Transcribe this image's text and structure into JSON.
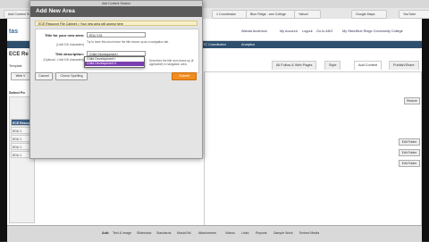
{
  "browser_tabs": [
    "Add Content Section",
    "Dashboard",
    "1 Coordinator",
    "Blue Ridge - ann College",
    "Yahoo!",
    "Google Maps",
    "YouTube",
    "Working Conditions",
    "Online Scheduling",
    "Community College",
    "sbt",
    "1 Coordinator",
    "Coordinator",
    "Coordinator",
    "Announcements"
  ],
  "header": {
    "logo": "tas",
    "links": [
      "Wanda Anderson",
      "My Account",
      "Logout",
      "Go to ANG",
      "My Sites",
      "Blue Ridge Community College"
    ]
  },
  "nav": {
    "items": [
      "TC Coordinator",
      "Analytics"
    ]
  },
  "page": {
    "title": "ECE Re",
    "template_label": "Template",
    "web_button": "Web V"
  },
  "page_tabs": [
    "All Follow & Web Pages",
    "Style",
    "Add Content",
    "Publish/Share"
  ],
  "sidebar": {
    "title": "Select Fo",
    "head_item": "ECE Resou",
    "items": [
      "EDU 1",
      "EDU 1",
      "EDU 1",
      "EDU 1"
    ]
  },
  "edit_buttons": [
    "Restore",
    "Edit Folder",
    "Edit Folder",
    "Edit Folder"
  ],
  "bottombar": {
    "add_label": "Add:",
    "items": [
      "Text & Image",
      "Slideshow",
      "Standards",
      "Music/Vid",
      "Attachments",
      "Videos",
      "Links",
      "Reports",
      "Sample Work",
      "Embed Media"
    ]
  },
  "dialog": {
    "window_title": "Add Content Section",
    "title": "Add New Area",
    "info_text": "ECE Resource File Cabinet > Your new area will appear here",
    "fields": {
      "title_label": "Title for your new area:",
      "title_sub": "(Limit 100 characters)",
      "title_value": "EDU 131",
      "title_help": "Try to have this short since the title shows up as a navigation tab.",
      "desc_label": "Title description:",
      "desc_sub": "(Optional - Limit 100 characters)",
      "desc_value": "Child Development I",
      "desc_help": "Describes the title and shows up (if applicable) in navigation area."
    },
    "dropdown_options": [
      "Child Development I",
      "Child Development II"
    ],
    "buttons": {
      "cancel": "Cancel",
      "spell": "Check Spelling",
      "submit": "Submit"
    }
  }
}
